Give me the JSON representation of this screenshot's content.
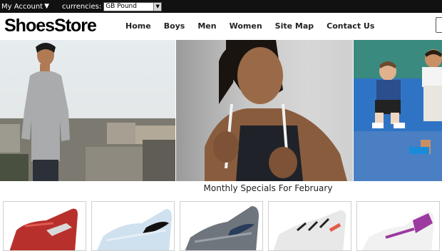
{
  "topbar": {
    "account_label": "My Account",
    "currencies_label": "currencies:",
    "currency_selected": "GB Pound"
  },
  "header": {
    "logo": "ShoesStore",
    "nav": [
      "Home",
      "Boys",
      "Men",
      "Women",
      "Site Map",
      "Contact Us"
    ]
  },
  "specials": {
    "title": "Monthly Specials For February"
  },
  "colors": {
    "topbar_bg": "#111111",
    "shoe1": "#b8302c",
    "shoe2": "#cfe1ef",
    "shoe3": "#6f757d",
    "shoe4": "#e8e8e8",
    "shoe5": "#9c3aa0"
  }
}
